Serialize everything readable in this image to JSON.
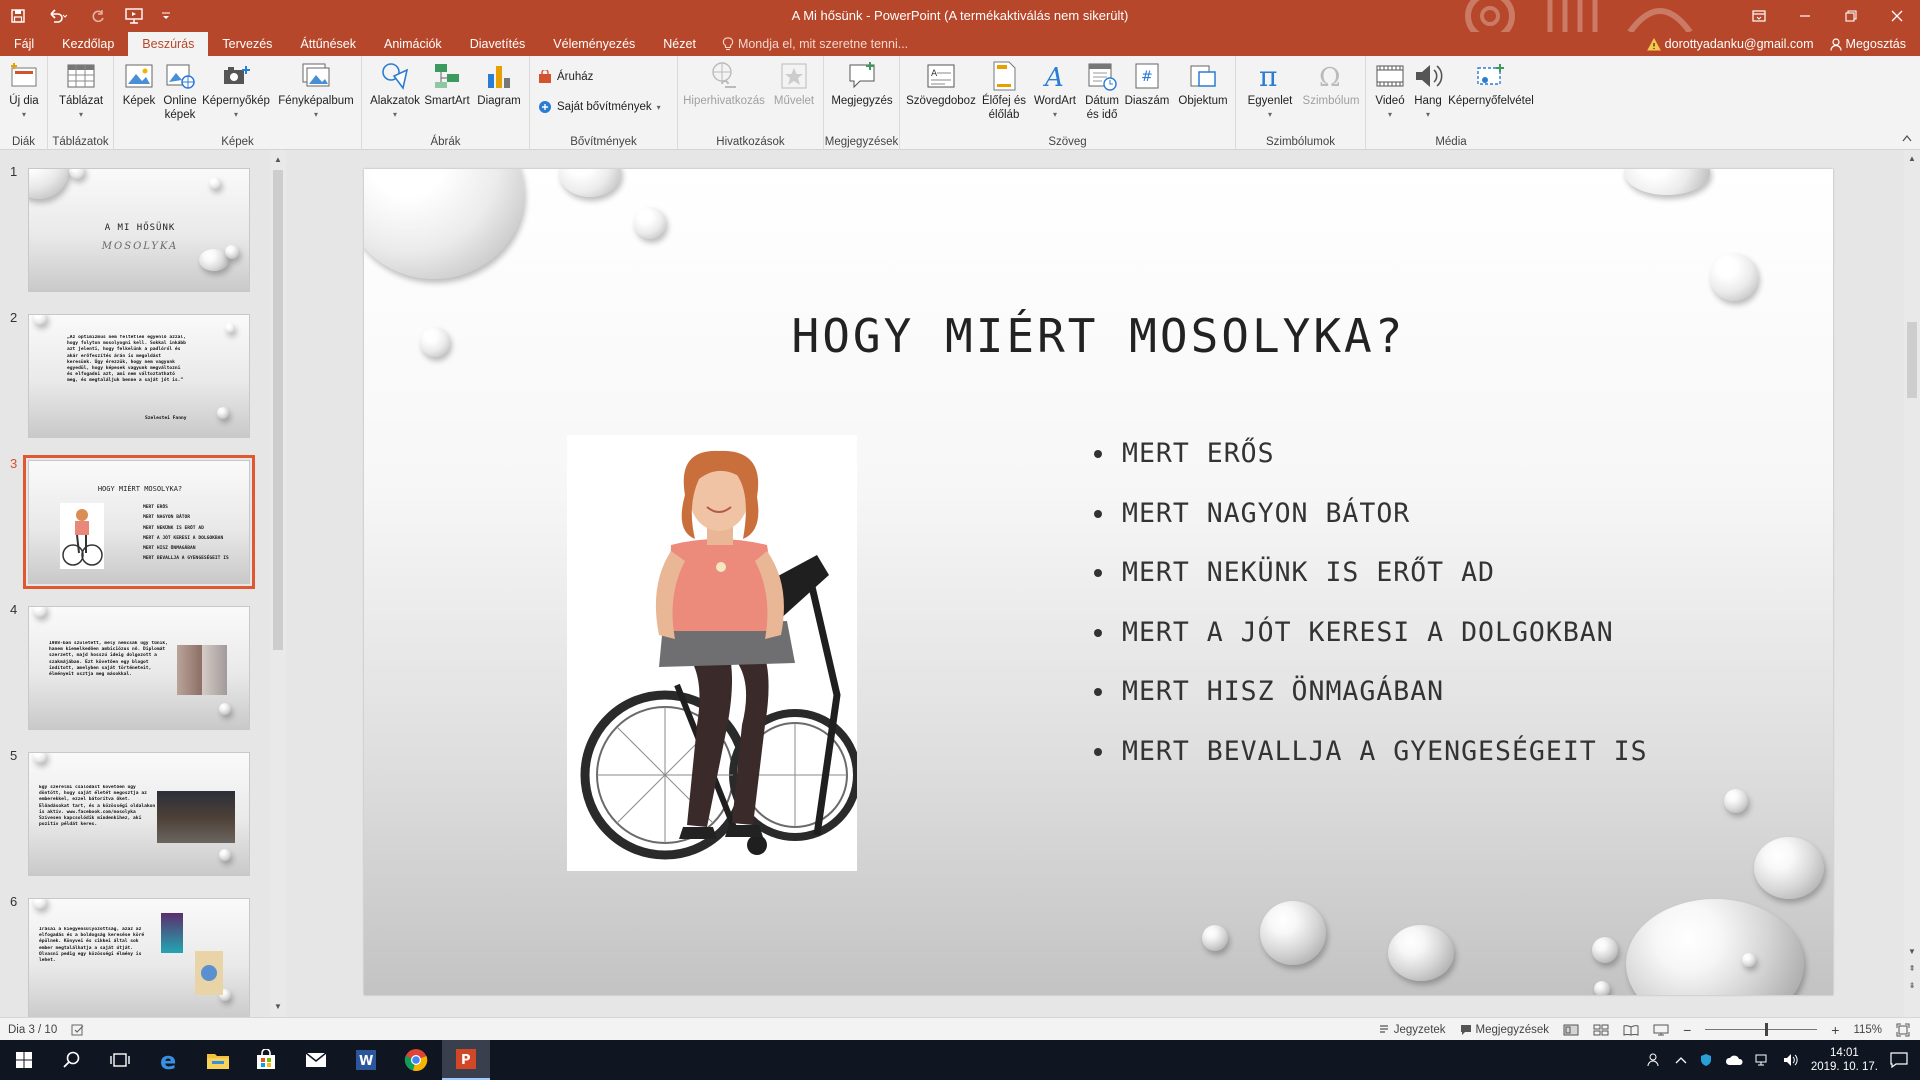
{
  "app": {
    "window_title": "A Mi hősünk - PowerPoint (A termékaktiválás nem sikerült)",
    "colors": {
      "accent": "#b7472a",
      "selection": "#e0582f"
    }
  },
  "tabs": [
    "Fájl",
    "Kezdőlap",
    "Beszúrás",
    "Tervezés",
    "Áttűnések",
    "Animációk",
    "Diavetítés",
    "Véleményezés",
    "Nézet"
  ],
  "active_tab": "Beszúrás",
  "tell_me": "Mondja el, mit szeretne tenni...",
  "account": {
    "email": "dorottyadanku@gmail.com",
    "share": "Megosztás"
  },
  "ribbon": {
    "groups": {
      "diak": "Diák",
      "tablazatok": "Táblázatok",
      "kepek": "Képek",
      "abrak": "Ábrák",
      "bovitmenyek": "Bővítmények",
      "hivatkozasok": "Hivatkozások",
      "megjegyzesek": "Megjegyzések",
      "szoveg": "Szöveg",
      "szimbolumok": "Szimbólumok",
      "media": "Média"
    },
    "buttons": {
      "new_slide": "Új dia",
      "table": "Táblázat",
      "pictures": "Képek",
      "online_pictures": "Online képek",
      "screenshot": "Képernyőkép",
      "photo_album": "Fényképalbum",
      "shapes": "Alakzatok",
      "smartart": "SmartArt",
      "chart": "Diagram",
      "store": "Áruház",
      "my_addins": "Saját bővítmények",
      "hyperlink": "Hiperhivatkozás",
      "action": "Művelet",
      "comment": "Megjegyzés",
      "textbox": "Szövegdoboz",
      "header_footer": "Élőfej és élőláb",
      "wordart": "WordArt",
      "date_time": "Dátum és idő",
      "slide_number": "Diaszám",
      "object": "Objektum",
      "equation": "Egyenlet",
      "symbol": "Szimbólum",
      "video": "Videó",
      "audio": "Hang",
      "screen_recording": "Képernyőfelvétel"
    }
  },
  "thumbnails": [
    {
      "num": "1",
      "title": "A MI HŐSÜNK",
      "subtitle": "MOSOLYKA"
    },
    {
      "num": "2",
      "text": "„Az optimizmus nem feltétlen egyenlő azzal, hogy folyton mosolyogni kell. Sokkal inkább azt jelenti, hogy felkelünk a padlóról és akár erőfeszítés árán is megoldást keresünk. Úgy érezzük, hogy nem vagyunk egyedül, hogy képesek vagyunk megváltozni és elfogadni azt, ami nem változtatható meg, és megtaláljuk benne a saját jót is.”",
      "author": "Szelestei Fanny"
    },
    {
      "num": "3",
      "title": "HOGY MIÉRT MOSOLYKA?",
      "bullets": [
        "MERT ERŐS",
        "MERT NAGYON BÁTOR",
        "MERT NEKÜNK IS ERŐT AD",
        "MERT A JÓT KERESI A DOLGOKBAN",
        "MERT HISZ ÖNMAGÁBAN",
        "MERT BEVALLJA A GYENGESÉGEIT IS"
      ]
    },
    {
      "num": "4",
      "text": "1988-ban született, mely nemcsak úgy tűnik, hanem kiemelkedően ambiciózus nő. Diplomát szerzett, majd hosszú ideig dolgozott a szakmájában. Ezt követően egy blogot indított, amelyben saját történeteit, élményeit osztja meg másokkal."
    },
    {
      "num": "5",
      "text": "Egy szerelmi csalódást követően úgy döntött, hogy saját életét megosztja az emberekkel, ezzel bátorítva őket. Előadásokat tart, és a közösségi oldalakon is aktív. www.facebook.com/mosolyka Szívesen kapcsolódik mindenkihez, aki pozitív példát keres."
    },
    {
      "num": "6",
      "text": "Írásai a kiegyensúlyozottság, azaz az elfogadás és a boldogság keresése köré épülnek. Könyvei és cikkei által sok ember megtalálhatja a saját útját. Olvasni pedig egy közösségi élmény is lehet."
    }
  ],
  "slide": {
    "title": "HOGY MIÉRT MOSOLYKA?",
    "bullets": [
      "MERT ERŐS",
      "MERT NAGYON BÁTOR",
      "MERT NEKÜNK IS ERŐT AD",
      "MERT A JÓT KERESI A DOLGOKBAN",
      "MERT HISZ ÖNMAGÁBAN",
      "MERT BEVALLJA A GYENGESÉGEIT IS"
    ]
  },
  "status": {
    "slide_of": "Dia 3 / 10",
    "notes": "Jegyzetek",
    "comments": "Megjegyzések",
    "zoom": "115%"
  },
  "taskbar": {
    "time": "14:01",
    "date": "2019. 10. 17."
  }
}
